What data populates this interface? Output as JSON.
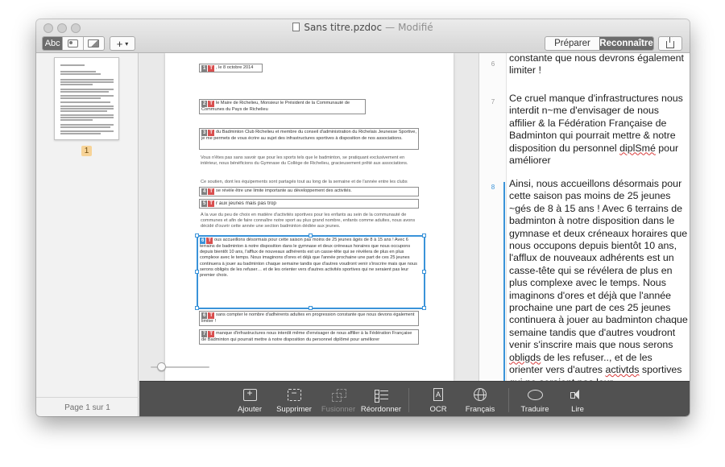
{
  "window": {
    "title": "Sans titre.pzdoc",
    "separator": "—",
    "status": "Modifié"
  },
  "toolbar": {
    "view_text_label": "Abc",
    "view_person_icon": "person-card-icon",
    "view_image_icon": "image-icon",
    "add_label": "+",
    "add_caret": "▾",
    "mode_prepare_label": "Préparer",
    "mode_recognize_label": "Reconnaître",
    "mode_active": "Reconnaître",
    "share_icon": "share-icon"
  },
  "sidebar": {
    "thumbnail_page_number": "1",
    "page_indicator": "Page 1 sur 1"
  },
  "document": {
    "blocks": [
      {
        "num": "1",
        "tag": "T",
        "text": ", le 8 octobre 2014"
      },
      {
        "num": "2",
        "tag": "T",
        "text": "le Maire de Richelieu, Monsieur le Président de la Communauté de Communes du Pays de Richelieu"
      },
      {
        "num": "3",
        "tag": "T",
        "text": "du Badminton Club Richelieu et membre du conseil d'administration du Richelais Jeunesse Sportive, je me permets de vous écrire au sujet des infrastructures sportives à disposition de nos associations."
      },
      {
        "num": "4",
        "tag": "T",
        "text": "se révèle être une limite importante au développement des activités."
      },
      {
        "num": "5",
        "tag": "T",
        "text": "r aux jeunes mais pas trop"
      },
      {
        "num": "6",
        "tag": "T",
        "text": "ous accueillons désormais pour cette saison pas moins de 25 jeunes âgés de 8 à 15 ans ! Avec 6 terrains de badminton à notre disposition dans le gymnase et deux créneaux horaires que nous occupons depuis bientôt 10 ans, l'afflux de nouveaux adhérents est un casse-tête qui se révélera de plus en plus complexe avec le temps. Nous imaginons d'ores et déjà que l'année prochaine une part de ces 25 jeunes continuera à jouer au badminton chaque semaine tandis que d'autres voudront venir s'inscrire mais que nous serons obligés de les refuser… et de les orienter vers d'autres activités sportives qui ne seraient pas leur premier choix."
      },
      {
        "num": "6",
        "tag": "T",
        "text": "sans compter le nombre d'adhérents adultes en progression constante que nous devons également limiter !"
      },
      {
        "num": "7",
        "tag": "T",
        "text": "manque d'infrastructures nous interdit même d'envisager de nous affilier à la Fédération Française de Badminton qui pourrait mettre à notre disposition du personnel diplômé pour améliorer"
      }
    ],
    "body_text": [
      "Vous n'êtes pas sans savoir que pour les sports tels que le badminton, se pratiquant exclusivement en intérieur, nous bénéficions du Gymnase du Collège de Richelieu, gracieusement prêté aux associations.",
      "Ce soutien, dont les équipements sont partagés tout au long de la semaine et de l'année entre les clubs",
      "À la vue du peu de choix en matière d'activités sportives pour les enfants au sein de la communauté de communes et afin de faire connaître notre sport au plus grand nombre, enfants comme adultes, nous avons décidé d'ouvrir cette année une section badminton dédiée aux jeunes."
    ],
    "zoom_percent": 20
  },
  "text_panel": {
    "paragraphs": [
      {
        "num": "6",
        "active": false,
        "text": "constante que nous devrons également limiter !"
      },
      {
        "num": "7",
        "active": false,
        "text_parts": [
          "Ce cruel manque d'infrastructures nous interdit n~me d'envisager de nous affilier & la Fédération Française de Badminton qui pourrait mettre & notre disposition du personnel ",
          "diplSmé",
          " pour améliorer"
        ]
      },
      {
        "num": "8",
        "active": true,
        "text_parts": [
          "Ainsi, nous accueillons désormais pour cette saison pas moins de 25 jeunes ~gés de 8 à 15 ans ! Avec 6 terrains de badminton à notre disposition dans le gymnase et deux créneaux horaires que nous occupons depuis bientôt 10 ans, l'afflux de nouveaux adhérents est un casse-tête qui se révélera de plus en plus complexe avec le temps. Nous imaginons d'ores et déjà que l'année prochaine une part de ces 25 jeunes continuera à jouer au badminton chaque semaine tandis que d'autres voudront venir s'inscrire mais que nous serons ",
          "obligds",
          " de les refuser.., et de les orienter vers d'autres ",
          "activtds",
          " sportives qui ne seraient pas leur"
        ]
      }
    ]
  },
  "bottom_toolbar": {
    "add_label": "Ajouter",
    "delete_label": "Supprimer",
    "merge_label": "Fusionner",
    "reorder_label": "Réordonner",
    "ocr_label": "OCR",
    "ocr_glyph": "A",
    "language_label": "Français",
    "translate_label": "Traduire",
    "read_label": "Lire"
  },
  "colors": {
    "selection": "#3a93d9",
    "tag_red": "#d84f4f",
    "toolbar_bg": "#515151",
    "page_badge": "#f7d397"
  }
}
